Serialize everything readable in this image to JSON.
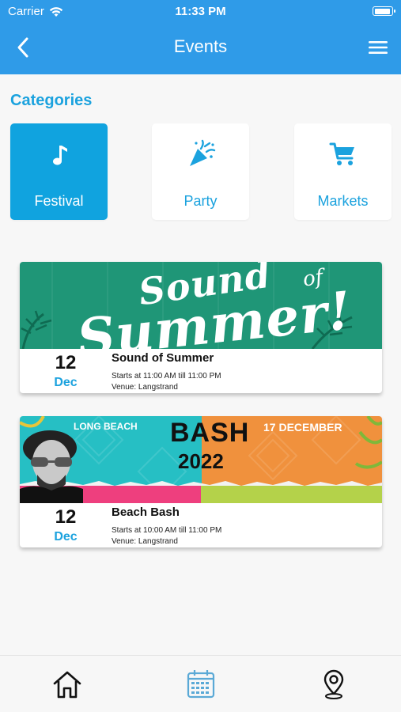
{
  "status": {
    "carrier": "Carrier",
    "time": "11:33 PM",
    "battery_level": 0.95
  },
  "nav": {
    "title": "Events"
  },
  "categories": {
    "heading": "Categories",
    "items": [
      {
        "label": "Festival",
        "icon": "music-note-icon",
        "selected": true
      },
      {
        "label": "Party",
        "icon": "party-popper-icon",
        "selected": false
      },
      {
        "label": "Markets",
        "icon": "shopping-cart-icon",
        "selected": false
      }
    ]
  },
  "events": [
    {
      "name": "Sound of Summer",
      "day": "12",
      "month": "Dec",
      "time": "Starts at 11:00 AM till 11:00 PM",
      "venue": "Venue: Langstrand",
      "banner": {
        "line1": "Sound",
        "line2": "of",
        "line3": "Summer!"
      }
    },
    {
      "name": "Beach Bash",
      "day": "12",
      "month": "Dec",
      "time": "Starts at 10:00 AM till 11:00 PM",
      "venue": "Venue: Langstrand",
      "banner": {
        "place": "LONG BEACH",
        "title": "BASH",
        "year": "2022",
        "date": "17 DECEMBER"
      }
    }
  ],
  "tabs": [
    {
      "icon": "home-icon",
      "active": false
    },
    {
      "icon": "calendar-icon",
      "active": true
    },
    {
      "icon": "map-pin-icon",
      "active": false
    }
  ],
  "colors": {
    "accent": "#1ba2de",
    "navbar": "#2f9be8",
    "selected_category": "#10a3df",
    "tab_active": "#5aa9d6"
  }
}
